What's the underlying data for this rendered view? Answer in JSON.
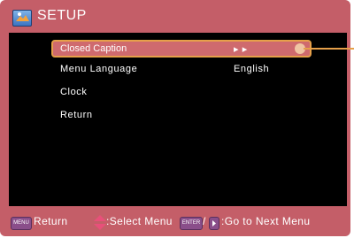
{
  "header": {
    "title": "SETUP",
    "logo_icon": "setup-logo-icon"
  },
  "menu": {
    "items": [
      {
        "label": "Closed Caption",
        "value": "▸ ▸",
        "selected": true
      },
      {
        "label": "Menu Language",
        "value": "English",
        "selected": false
      },
      {
        "label": "Clock",
        "value": "",
        "selected": false
      },
      {
        "label": "Return",
        "value": "",
        "selected": false
      }
    ]
  },
  "footer": {
    "menu_key": "MENU",
    "return_text": "Return",
    "updown_icon": "up-down-arrows-icon",
    "select_text": ":Select Menu",
    "enter_key": "ENTER",
    "separator": "/",
    "right_icon": "right-arrow-icon",
    "next_text": ":Go to Next Menu"
  },
  "colors": {
    "frame": "#c45e68",
    "panel": "#000000",
    "highlight": "#cf6a6e",
    "highlight_border": "#e6a04a",
    "key_button": "#8a4e8a"
  }
}
